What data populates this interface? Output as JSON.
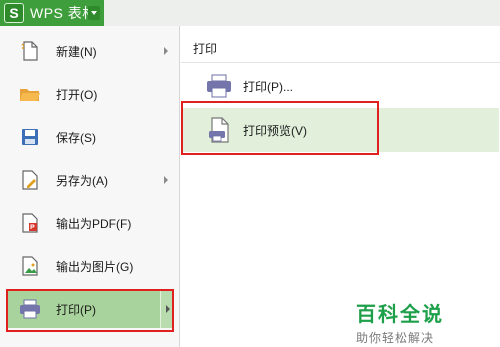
{
  "app": {
    "logo_letter": "S",
    "title": "WPS 表格"
  },
  "menu": {
    "items": [
      {
        "label": "新建(N)",
        "icon": "new-document-icon",
        "has_submenu": true
      },
      {
        "label": "打开(O)",
        "icon": "open-folder-icon",
        "has_submenu": false
      },
      {
        "label": "保存(S)",
        "icon": "save-icon",
        "has_submenu": false
      },
      {
        "label": "另存为(A)",
        "icon": "save-as-icon",
        "has_submenu": true
      },
      {
        "label": "输出为PDF(F)",
        "icon": "export-pdf-icon",
        "has_submenu": false
      },
      {
        "label": "输出为图片(G)",
        "icon": "export-image-icon",
        "has_submenu": false
      },
      {
        "label": "打印(P)",
        "icon": "printer-icon",
        "has_submenu": true,
        "selected": true
      }
    ]
  },
  "submenu": {
    "title": "打印",
    "items": [
      {
        "label": "打印(P)...",
        "icon": "printer-icon"
      },
      {
        "label": "打印预览(V)",
        "icon": "print-preview-icon",
        "hovered": true
      }
    ]
  },
  "watermark": {
    "title": "百科全说",
    "subtitle": "助你轻松解决"
  },
  "colors": {
    "app_green": "#3f9e3c",
    "selected_green": "#a9d39c",
    "hover_green": "#e1efdb",
    "highlight_red": "#e01f1f",
    "watermark_green": "#1ea04a"
  }
}
